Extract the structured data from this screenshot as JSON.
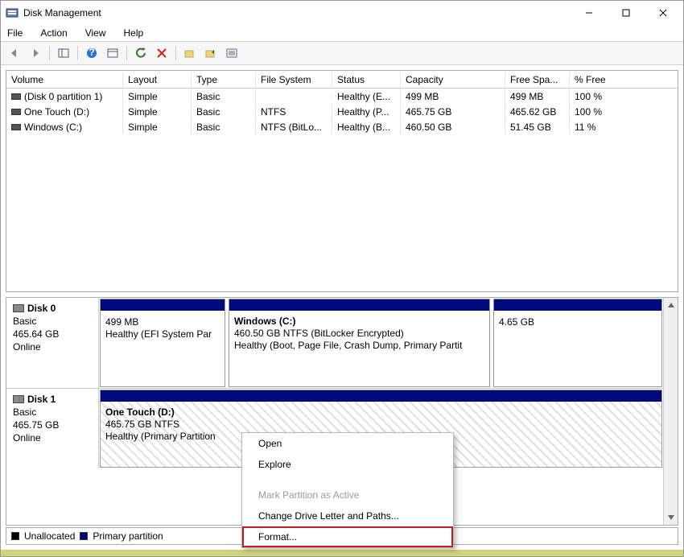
{
  "window": {
    "title": "Disk Management"
  },
  "menus": {
    "file": "File",
    "action": "Action",
    "view": "View",
    "help": "Help"
  },
  "table": {
    "headers": {
      "volume": "Volume",
      "layout": "Layout",
      "type": "Type",
      "fs": "File System",
      "status": "Status",
      "capacity": "Capacity",
      "free": "Free Spa...",
      "pct": "% Free"
    },
    "rows": [
      {
        "vol": "(Disk 0 partition 1)",
        "lay": "Simple",
        "typ": "Basic",
        "fs": "",
        "st": "Healthy (E...",
        "cap": "499 MB",
        "fr": "499 MB",
        "pct": "100 %"
      },
      {
        "vol": "One Touch (D:)",
        "lay": "Simple",
        "typ": "Basic",
        "fs": "NTFS",
        "st": "Healthy (P...",
        "cap": "465.75 GB",
        "fr": "465.62 GB",
        "pct": "100 %"
      },
      {
        "vol": "Windows (C:)",
        "lay": "Simple",
        "typ": "Basic",
        "fs": "NTFS (BitLo...",
        "st": "Healthy (B...",
        "cap": "460.50 GB",
        "fr": "51.45 GB",
        "pct": "11 %"
      }
    ]
  },
  "disks": {
    "d0": {
      "name": "Disk 0",
      "type": "Basic",
      "size": "465.64 GB",
      "status": "Online",
      "parts": [
        {
          "title": "",
          "line1": "499 MB",
          "line2": "Healthy (EFI System Par"
        },
        {
          "title": "Windows  (C:)",
          "line1": "460.50 GB NTFS (BitLocker Encrypted)",
          "line2": "Healthy (Boot, Page File, Crash Dump, Primary Partit"
        },
        {
          "title": "",
          "line1": "4.65 GB",
          "line2": ""
        }
      ]
    },
    "d1": {
      "name": "Disk 1",
      "type": "Basic",
      "size": "465.75 GB",
      "status": "Online",
      "parts": [
        {
          "title": "One Touch  (D:)",
          "line1": "465.75 GB NTFS",
          "line2": "Healthy (Primary Partition"
        }
      ]
    }
  },
  "legend": {
    "unalloc": "Unallocated",
    "primary": "Primary partition"
  },
  "ctx": {
    "open": "Open",
    "explore": "Explore",
    "mark": "Mark Partition as Active",
    "change": "Change Drive Letter and Paths...",
    "format": "Format..."
  }
}
